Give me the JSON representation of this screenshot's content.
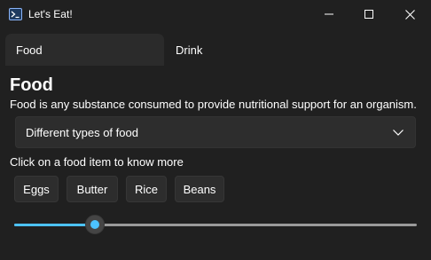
{
  "window": {
    "title": "Let's Eat!"
  },
  "tabs": [
    {
      "label": "Food",
      "selected": true
    },
    {
      "label": "Drink",
      "selected": false
    }
  ],
  "content": {
    "heading": "Food",
    "description": "Food is any substance consumed to provide nutritional support for an organism.",
    "combo": {
      "value": "Different types of food"
    },
    "prompt": "Click on a food item to know more",
    "buttons": [
      "Eggs",
      "Butter",
      "Rice",
      "Beans"
    ],
    "slider": {
      "value": 0.2
    }
  },
  "colors": {
    "accent": "#4cc2ff",
    "background": "#202020",
    "control": "#2d2d2d"
  }
}
